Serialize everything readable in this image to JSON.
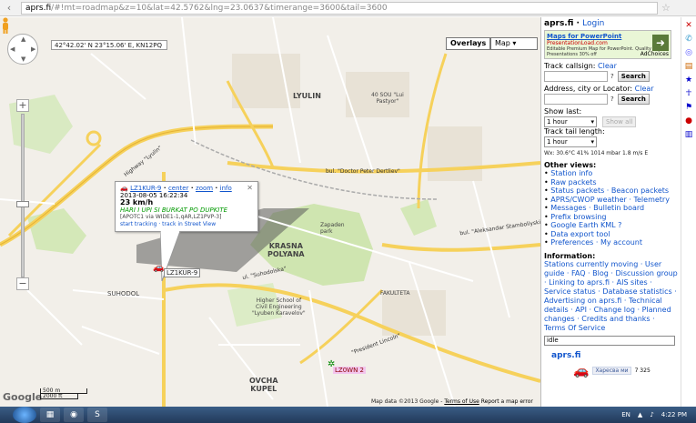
{
  "browser": {
    "url_host": "aprs.fi",
    "url_path": "/#!mt=roadmap&z=10&lat=42.5762&lng=23.0637&timerange=3600&tail=3600"
  },
  "map": {
    "coords": "42°42.02' N 23°15.06' E, KN12PQ",
    "overlays_label": "Overlays",
    "maptype_label": "Map",
    "labels": {
      "lyulin": "LYULIN",
      "krasna_polyana": "KRASNA\nPOLYANA",
      "zapaden_park": "Zapaden\npark",
      "suhodol": "SUHODOL",
      "ovcha_kupel": "OVCHA\nKUPEL",
      "fakulteta": "FAKULTETA",
      "sofia_univ": "Higher School of\nCivil Engineering\n\"Lyuben Karavelov\"",
      "dervenitsa": "40 SOU \"Lui\nPastyor\"",
      "highway": "Highway \"Lyulin\"",
      "bul_dzherev": "bul. \"Doctor Peter Dertliev\"",
      "suhodolska": "ul. \"Suhodolska\"",
      "lincoln": "\"President Lincoln\"",
      "stamboliyski": "bul. \"Aleksandar Stamboliyski\"",
      "car_label_main": "LZ1KUR-9",
      "car_label_2": "LZ0WN 2"
    },
    "footer_data": "Map data ©2013 Google",
    "footer_terms": "Terms of Use",
    "footer_report": "Report a map error",
    "google_logo": "Google",
    "scale_m": "500 m",
    "scale_ft": "2000 ft"
  },
  "popup": {
    "callsign": "LZ1KUR-9",
    "links_center": "center",
    "links_zoom": "zoom",
    "links_info": "info",
    "time": "2013-08-05 16:22:34",
    "speed": "23 km/h",
    "comment": "HARI I UPI SI BURKAT PO DUPKITE",
    "path": "[APOTC1 via WIDE1-1,qAR,LZ1PVP-3]",
    "start_tracking": "start tracking",
    "street_view": "track in Street View"
  },
  "sidebar": {
    "site": "aprs.fi",
    "login": "Login",
    "ad_title": "Maps for PowerPoint",
    "ad_logo": "PresentationLoad.com",
    "ad_text": "Editable Premium Map for PowerPoint. Quality Presentations 30% off",
    "ad_choices": "AdChoices",
    "track_callsign_label": "Track callsign:",
    "clear": "Clear",
    "search": "Search",
    "address_label": "Address, city or Locator:",
    "show_last_label": "Show last:",
    "show_last_value": "1 hour",
    "show_all": "Show all",
    "tail_label": "Track tail length:",
    "tail_value": "1 hour",
    "wx": "Wx: 30.6°C 41% 1014 mbar 1.8 m/s E",
    "other_views": "Other views:",
    "views": [
      "Station info",
      "Raw packets",
      "Status packets · Beacon packets",
      "APRS/CWOP weather · Telemetry",
      "Messages · Bulletin board",
      "Prefix browsing",
      "Google Earth KML ?",
      "Data export tool",
      "Preferences · My account"
    ],
    "information": "Information:",
    "info_text": "Stations currently moving · User guide · FAQ · Blog · Discussion group · Linking to aprs.fi · AIS sites · Service status · Database statistics · Advertising on aprs.fi · Technical details · API · Change log · Planned changes · Credits and thanks · Terms Of Service",
    "filter_value": "idle",
    "brand": "aprs.fi",
    "like_label": "Харесва ми",
    "like_count": "7 325"
  },
  "taskbar": {
    "lang": "EN",
    "time": "4:22 PM"
  }
}
